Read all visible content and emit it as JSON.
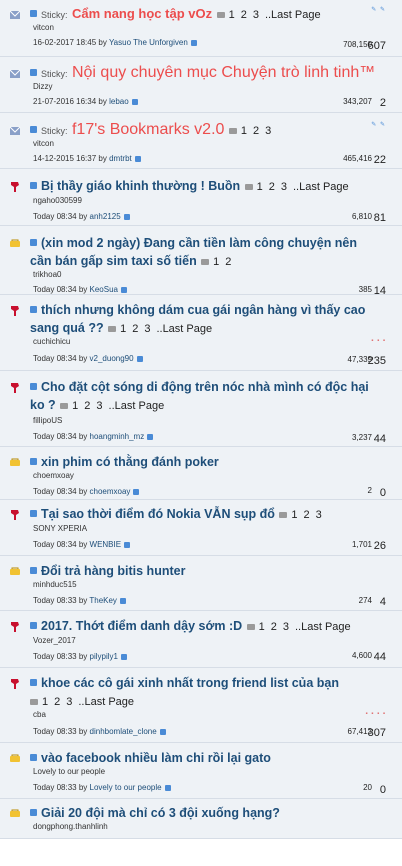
{
  "threads": [
    {
      "type": "sticky",
      "prefix": "Sticky:",
      "title": "Cẩm nang học tập vOz",
      "pages": [
        "1",
        "2",
        "3"
      ],
      "last_page": "..Last Page",
      "author": "vitcon",
      "last_post": "16-02-2017 18:45",
      "last_poster": "Yasuo The Unforgiven",
      "views": "708,150",
      "replies": "607",
      "rating": "✎ ✎"
    },
    {
      "type": "sticky",
      "prefix": "Sticky:",
      "title": "Nội quy chuyên mục Chuyện trò linh tinh™",
      "pages": [],
      "last_page": "",
      "author": "Dizzy",
      "last_post": "21-07-2016 16:34",
      "last_poster": "lebao",
      "views": "343,207",
      "replies": "2",
      "rating": ""
    },
    {
      "type": "sticky",
      "prefix": "Sticky:",
      "title": "f17's Bookmarks v2.0",
      "pages": [
        "1",
        "2",
        "3"
      ],
      "last_page": "",
      "author": "vitcon",
      "last_post": "14-12-2015 16:37",
      "last_poster": "dmtrbt",
      "views": "465,416",
      "replies": "22",
      "rating": "✎ ✎"
    },
    {
      "type": "hot",
      "prefix": "",
      "title": "Bị thầy giáo khinh thường ! Buồn",
      "pages": [
        "1",
        "2",
        "3"
      ],
      "last_page": "..Last Page",
      "author": "ngaho030599",
      "last_post": "Today 08:34",
      "last_poster": "anh2125",
      "views": "6,810",
      "replies": "81",
      "rating": ""
    },
    {
      "type": "new",
      "prefix": "",
      "title": "(xin mod 2 ngày) Đang cần tiền làm công chuyện nên cần bán gấp sim taxi số tiến",
      "pages": [
        "1",
        "2"
      ],
      "last_page": "",
      "author": "trikhoa0",
      "last_post": "Today 08:34",
      "last_poster": "KeoSua",
      "views": "385",
      "replies": "14",
      "rating": ""
    },
    {
      "type": "hot",
      "prefix": "",
      "title": "thích nhưng không dám cua gái ngân hàng vì thấy cao sang quá ??",
      "pages": [
        "1",
        "2",
        "3"
      ],
      "last_page": "..Last Page",
      "author": "cuchichicu",
      "last_post": "Today 08:34",
      "last_poster": "v2_duong90",
      "views": "47,339",
      "replies": "235",
      "rating": "▪ ▪ ▪"
    },
    {
      "type": "hot",
      "prefix": "",
      "title": "Cho đặt cột sóng di động trên nóc nhà mình có độc hại ko ?",
      "pages": [
        "1",
        "2",
        "3"
      ],
      "last_page": "..Last Page",
      "author": "fillipoUS",
      "last_post": "Today 08:34",
      "last_poster": "hoangminh_mz",
      "views": "3,237",
      "replies": "44",
      "rating": ""
    },
    {
      "type": "new",
      "prefix": "",
      "title": "xin phim có thằng đánh poker",
      "pages": [],
      "last_page": "",
      "author": "choemxoay",
      "last_post": "Today 08:34",
      "last_poster": "choemxoay",
      "views": "2",
      "replies": "0",
      "rating": ""
    },
    {
      "type": "hot",
      "prefix": "",
      "title": "Tại sao thời điểm đó Nokia VẪN sụp đổ",
      "pages": [
        "1",
        "2",
        "3"
      ],
      "last_page": "",
      "author": "SONY XPERIA",
      "last_post": "Today 08:34",
      "last_poster": "WENBIE",
      "views": "1,701",
      "replies": "26",
      "rating": ""
    },
    {
      "type": "new",
      "prefix": "",
      "title": "Đổi trả hàng bitis hunter",
      "pages": [],
      "last_page": "",
      "author": "minhduc515",
      "last_post": "Today 08:33",
      "last_poster": "TheKey",
      "views": "274",
      "replies": "4",
      "rating": ""
    },
    {
      "type": "hot",
      "prefix": "",
      "title": "2017. Thớt điểm danh dậy sớm :D",
      "pages": [
        "1",
        "2",
        "3"
      ],
      "last_page": "..Last Page",
      "author": "Vozer_2017",
      "last_post": "Today 08:33",
      "last_poster": "pilypily1",
      "views": "4,600",
      "replies": "44",
      "rating": ""
    },
    {
      "type": "hot",
      "prefix": "",
      "title": "khoe các cô gái xinh nhất trong friend list của bạn",
      "pages": [
        "1",
        "2",
        "3"
      ],
      "last_page": "..Last Page",
      "author": "cba",
      "last_post": "Today 08:33",
      "last_poster": "dinhbomlate_clone",
      "views": "67,412",
      "replies": "307",
      "rating": "▪ ▪ ▪ ▪"
    },
    {
      "type": "new",
      "prefix": "",
      "title": "vào facebook nhiều làm chi rồi lại gato",
      "pages": [],
      "last_page": "",
      "author": "Lovely to our people",
      "last_post": "Today 08:33",
      "last_poster": "Lovely to our people",
      "views": "20",
      "replies": "0",
      "rating": ""
    },
    {
      "type": "new",
      "prefix": "",
      "title": "Giải 20 đội mà chỉ có 3 đội xuống hạng?",
      "pages": [],
      "last_page": "",
      "author": "dongphong.thanhlinh",
      "last_post": "",
      "last_poster": "",
      "views": "",
      "replies": "",
      "rating": ""
    }
  ],
  "labels": {
    "today_by": "by"
  }
}
